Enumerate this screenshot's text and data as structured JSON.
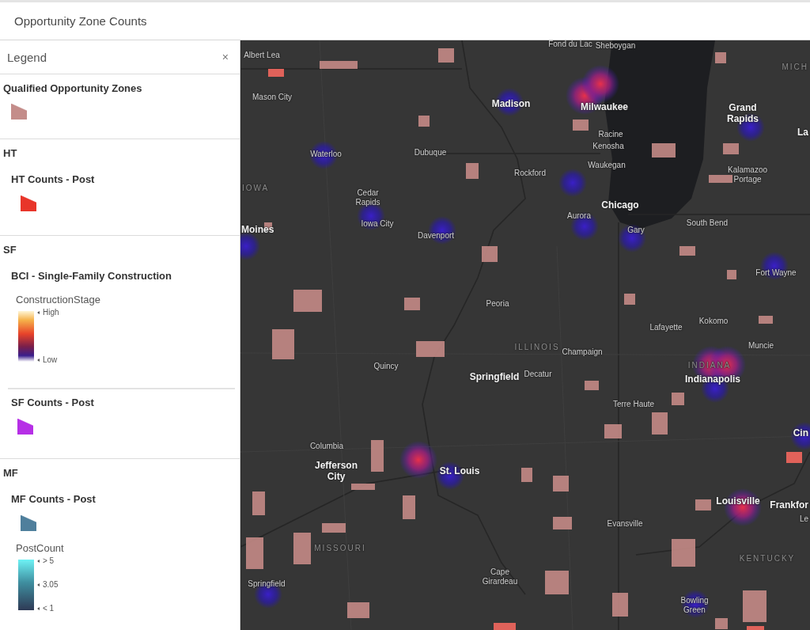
{
  "header": {
    "title": "Opportunity Zone Counts"
  },
  "legend": {
    "title": "Legend",
    "close": "×",
    "sections": [
      {
        "title": "Qualified Opportunity Zones",
        "layers": [
          {
            "symbols": [
              {
                "kind": "swatch",
                "color": "#c48d8a"
              }
            ]
          }
        ]
      },
      {
        "title": "HT",
        "layers": [
          {
            "title": "HT Counts - Post",
            "symbols": [
              {
                "kind": "swatch",
                "color": "#e8352a"
              }
            ]
          }
        ]
      },
      {
        "title": "SF",
        "layers": [
          {
            "title": "BCI - Single-Family Construction",
            "symbols": [
              {
                "kind": "heatramp",
                "field": "ConstructionStage",
                "stops": [
                  "High",
                  "Low"
                ]
              }
            ]
          },
          {
            "title": "SF Counts - Post",
            "symbols": [
              {
                "kind": "swatch",
                "color": "#b62fe6"
              }
            ]
          }
        ]
      },
      {
        "title": "MF",
        "layers": [
          {
            "title": "MF Counts - Post",
            "symbols": [
              {
                "kind": "swatch",
                "color": "#4f7f9c"
              },
              {
                "kind": "tealramp",
                "field": "PostCount",
                "stops": [
                  "> 5",
                  "3.05",
                  "< 1"
                ]
              }
            ]
          }
        ]
      }
    ]
  },
  "map": {
    "labels": [
      {
        "text": "Albert Lea",
        "kind": "city"
      },
      {
        "text": "Mason City",
        "kind": "city"
      },
      {
        "text": "Waterloo",
        "kind": "city"
      },
      {
        "text": "Dubuque",
        "kind": "city"
      },
      {
        "text": "IOWA",
        "kind": "state"
      },
      {
        "text": "Cedar Rapids",
        "kind": "city"
      },
      {
        "text": "Iowa City",
        "kind": "city"
      },
      {
        "text": "Moines",
        "kind": "major"
      },
      {
        "text": "Davenport",
        "kind": "city"
      },
      {
        "text": "Madison",
        "kind": "major"
      },
      {
        "text": "Rockford",
        "kind": "city"
      },
      {
        "text": "Fond du Lac",
        "kind": "city"
      },
      {
        "text": "Sheboygan",
        "kind": "city"
      },
      {
        "text": "Milwaukee",
        "kind": "major"
      },
      {
        "text": "Racine",
        "kind": "city"
      },
      {
        "text": "Kenosha",
        "kind": "city"
      },
      {
        "text": "Waukegan",
        "kind": "city"
      },
      {
        "text": "Chicago",
        "kind": "major"
      },
      {
        "text": "Aurora",
        "kind": "city"
      },
      {
        "text": "Gary",
        "kind": "city"
      },
      {
        "text": "South Bend",
        "kind": "city"
      },
      {
        "text": "Grand Rapids",
        "kind": "major"
      },
      {
        "text": "Kalamazoo Portage",
        "kind": "city"
      },
      {
        "text": "MICH",
        "kind": "state"
      },
      {
        "text": "La",
        "kind": "major"
      },
      {
        "text": "Fort Wayne",
        "kind": "city"
      },
      {
        "text": "Peoria",
        "kind": "city"
      },
      {
        "text": "ILLINOIS",
        "kind": "state"
      },
      {
        "text": "Champaign",
        "kind": "city"
      },
      {
        "text": "Lafayette",
        "kind": "city"
      },
      {
        "text": "Kokomo",
        "kind": "city"
      },
      {
        "text": "Muncie",
        "kind": "city"
      },
      {
        "text": "Decatur",
        "kind": "city"
      },
      {
        "text": "Springfield",
        "kind": "major"
      },
      {
        "text": "Quincy",
        "kind": "city"
      },
      {
        "text": "INDIANA",
        "kind": "state"
      },
      {
        "text": "Indianapolis",
        "kind": "major"
      },
      {
        "text": "Terre Haute",
        "kind": "city"
      },
      {
        "text": "Cin",
        "kind": "major"
      },
      {
        "text": "Columbia",
        "kind": "city"
      },
      {
        "text": "Jefferson City",
        "kind": "major"
      },
      {
        "text": "St. Louis",
        "kind": "major"
      },
      {
        "text": "Frankfor",
        "kind": "major"
      },
      {
        "text": "Louisville",
        "kind": "major"
      },
      {
        "text": "Le",
        "kind": "city"
      },
      {
        "text": "Evansville",
        "kind": "city"
      },
      {
        "text": "MISSOURI",
        "kind": "state"
      },
      {
        "text": "KENTUCKY",
        "kind": "state"
      },
      {
        "text": "Springfield",
        "kind": "city"
      },
      {
        "text": "Cape Girardeau",
        "kind": "city"
      },
      {
        "text": "Bowling Green",
        "kind": "city"
      }
    ]
  }
}
